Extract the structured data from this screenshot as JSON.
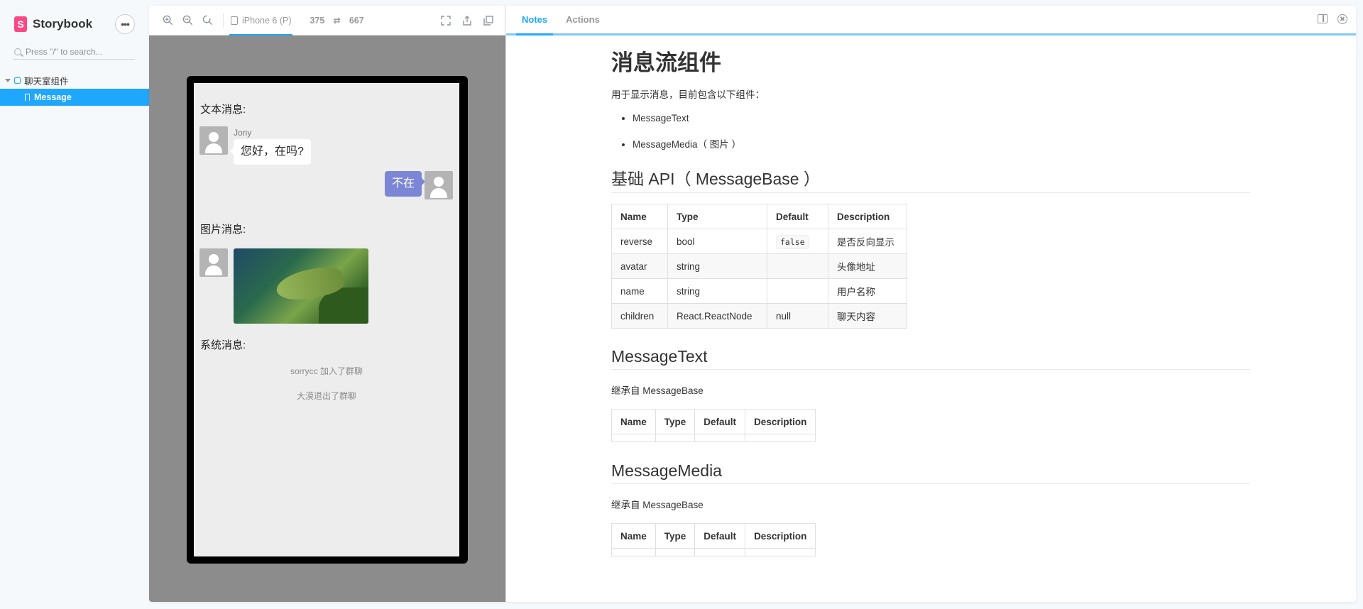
{
  "sidebar": {
    "brand": "Storybook",
    "brand_logo_letter": "S",
    "menu_label": "•••",
    "search_placeholder": "Press \"/\" to search...",
    "group_label": "聊天室组件",
    "item_label": "Message"
  },
  "preview": {
    "device_label": "iPhone 6 (P)",
    "width": "375",
    "swap_symbol": "⇄",
    "height": "667",
    "chat": {
      "text_section": "文本消息:",
      "sender_name": "Jony",
      "incoming_text": "您好，在吗?",
      "outgoing_text": "不在",
      "image_section": "图片消息:",
      "system_section": "系统消息:",
      "system_messages": [
        "sorrycc 加入了群聊",
        "大漠退出了群聊"
      ]
    }
  },
  "addon": {
    "tabs": [
      "Notes",
      "Actions"
    ],
    "active_tab": "Notes",
    "doc": {
      "title": "消息流组件",
      "intro": "用于显示消息，目前包含以下组件：",
      "list": [
        "MessageText",
        "MessageMedia（ 图片 ）"
      ],
      "base_heading": "基础 API（ MessageBase ）",
      "table_headers": [
        "Name",
        "Type",
        "Default",
        "Description"
      ],
      "base_rows": [
        {
          "name": "reverse",
          "type": "bool",
          "default": "false",
          "desc": "是否反向显示"
        },
        {
          "name": "avatar",
          "type": "string",
          "default": "",
          "desc": "头像地址"
        },
        {
          "name": "name",
          "type": "string",
          "default": "",
          "desc": "用户名称"
        },
        {
          "name": "children",
          "type": "React.ReactNode",
          "default": "null",
          "desc": "聊天内容"
        }
      ],
      "text_heading": "MessageText",
      "text_inherit": "继承自 MessageBase",
      "media_heading": "MessageMedia",
      "media_inherit": "继承自 MessageBase"
    }
  }
}
